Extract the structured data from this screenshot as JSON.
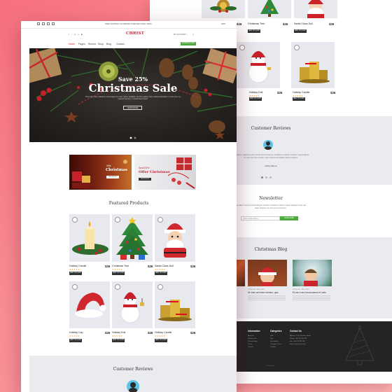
{
  "topbar": {
    "text": "FREE SHIPPING ON ORDERS OVER $99 CODE: XMAS",
    "extra": "INFO"
  },
  "brand": {
    "name": "CHRIST"
  },
  "header": {
    "account": "MY ACCOUNT",
    "cart_button": "SHOPPING CART"
  },
  "nav": [
    "Home",
    "Pages",
    "Recent",
    "Shop",
    "Blog",
    "Contact"
  ],
  "hero": {
    "save_text": "Save 25%",
    "title": "Christmas Sale",
    "subtitle": "There are many variations of passages of Lorem Ipsum available, but the majority have suffered alteration in some form, by injected humour, or randomised words.",
    "button": "LEARN MORE"
  },
  "banners": [
    {
      "small": "Gifts",
      "title": "Christmas",
      "button": "SHOP NOW"
    },
    {
      "small": "Save25%",
      "title": "Offer Christmas",
      "button": "SHOP NOW"
    }
  ],
  "featured": {
    "title": "Featured Products",
    "products": [
      {
        "name": "Holiday Candle",
        "price": "$26",
        "button": "ADD TO CART"
      },
      {
        "name": "Christmas Tree",
        "price": "$26",
        "button": "ADD TO CART"
      },
      {
        "name": "Santa Claus Doll",
        "price": "$26",
        "button": "ADD TO CART"
      },
      {
        "name": "Holiday Cap",
        "price": "$26",
        "button": "ADD TO CART"
      },
      {
        "name": "Holiday Doll",
        "price": "$26",
        "button": "ADD TO CART"
      },
      {
        "name": "Holiday Candle",
        "price": "$26",
        "button": "ADD TO CART"
      }
    ]
  },
  "reviews": {
    "title": "Customer Reviews",
    "text": "Consectetur adipiscing elit, sed do eiusmod tempor incididunt ut labore et dolore magna aliqua. Ut enim ad minim veniam, quis nostrud exercitation ullamco laboris.",
    "author": "Kathy Moore"
  },
  "back": {
    "top_products": [
      {
        "name": "Holiday Candle",
        "price": "$26",
        "button": "ADD TO CART"
      },
      {
        "name": "Christmas Tree",
        "price": "$26",
        "button": "ADD TO CART"
      },
      {
        "name": "Santa Claus Doll",
        "price": "$26",
        "button": "ADD TO CART"
      }
    ],
    "row2_products": [
      {
        "name": "Holiday Doll",
        "price": "$26",
        "button": "ADD TO CART"
      },
      {
        "name": "Holiday Candle",
        "price": "$26",
        "button": "ADD TO CART"
      }
    ],
    "newsletter": {
      "title": "Newsletter",
      "text": "Sed diam nonumy eirmod tempor invidunt ut labore et dolore magna aliquyam erat, sed diam voluptua. At vero eos et accusam.",
      "placeholder": "Enter email address",
      "button": "SUBSCRIBE"
    },
    "blog": {
      "title": "Christmas Blog",
      "posts": [
        {
          "meta": "Christmas · May 2020",
          "title": "Ut enim ad minim veniam, quis"
        },
        {
          "meta": "Christmas · May 2020",
          "title": "Et vero eos et accusamus et iusto"
        }
      ]
    },
    "footer": {
      "columns": [
        {
          "title": "Information",
          "items": [
            "About Us",
            "Delivery Info",
            "Privacy Policy",
            "Terms",
            "Contact"
          ]
        },
        {
          "title": "Categories",
          "items": [
            "Gifts",
            "Toys",
            "Decorations",
            "Christmas Trees",
            "Candles"
          ]
        },
        {
          "title": "Contact Us",
          "items": [
            "Address: 123 Christmas Street",
            "Phone: +00 123 456 789",
            "Fax: +00 123 456 789",
            "Email: info@christ.com"
          ]
        }
      ],
      "copyright": "© Christ 2020"
    }
  }
}
